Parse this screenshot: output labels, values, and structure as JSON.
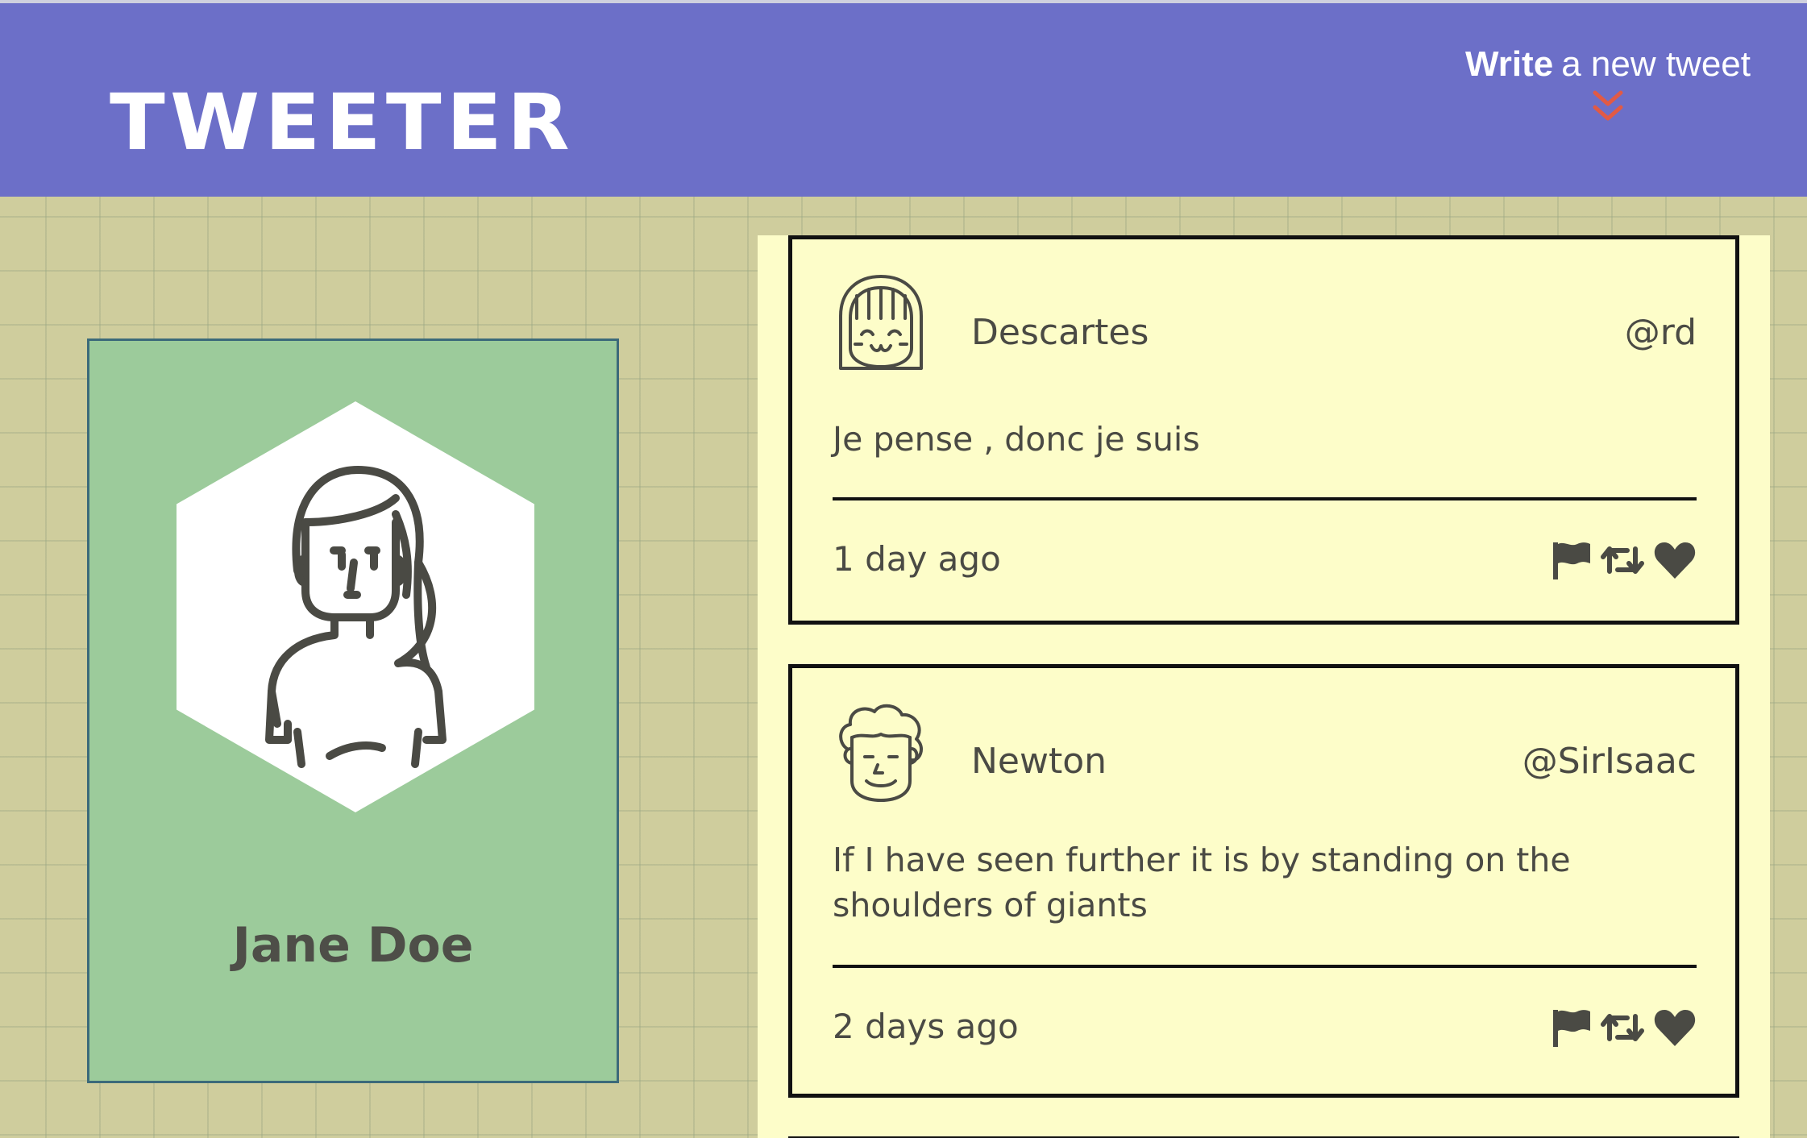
{
  "header": {
    "brand": "TWEETER",
    "compose_strong": "Write",
    "compose_rest": "a new tweet"
  },
  "profile": {
    "name": "Jane Doe"
  },
  "tweets": [
    {
      "author": "Descartes",
      "handle": "@rd",
      "content": "Je pense , donc je suis",
      "time": "1 day ago"
    },
    {
      "author": "Newton",
      "handle": "@SirIsaac",
      "content": "If I have seen further it is by standing on the shoulders of giants",
      "time": "2 days ago"
    }
  ],
  "colors": {
    "navbar": "#6c6fc8",
    "accent_chevron": "#e15a45",
    "profile_bg": "#9ccb9b",
    "feed_bg": "#fdfdc9",
    "page_bg": "#cfcd9d"
  },
  "icons": [
    "double-chevron-down-icon",
    "flag-icon",
    "retweet-icon",
    "heart-icon"
  ]
}
